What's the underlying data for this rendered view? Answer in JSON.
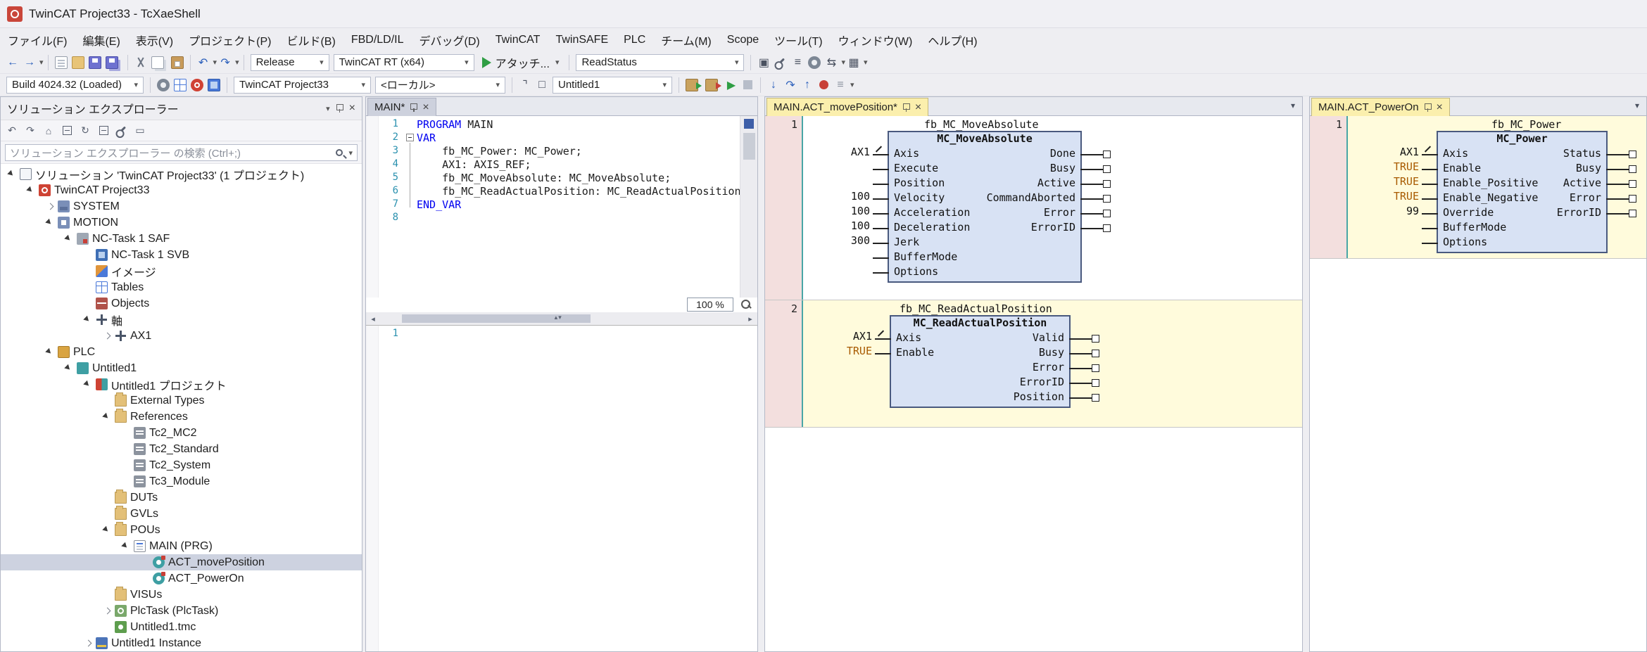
{
  "window": {
    "title": "TwinCAT Project33 - TcXaeShell"
  },
  "menu": {
    "items": [
      "ファイル(F)",
      "編集(E)",
      "表示(V)",
      "プロジェクト(P)",
      "ビルド(B)",
      "FBD/LD/IL",
      "デバッグ(D)",
      "TwinCAT",
      "TwinSAFE",
      "PLC",
      "チーム(M)",
      "Scope",
      "ツール(T)",
      "ウィンドウ(W)",
      "ヘルプ(H)"
    ]
  },
  "toolbar_standard": {
    "solution_config": "Release",
    "platform": "TwinCAT RT (x64)",
    "attach": "アタッチ...",
    "readstatus": "ReadStatus",
    "icons": [
      "nav-back-icon",
      "nav-forward-icon",
      "new-file-icon",
      "open-file-icon",
      "save-icon",
      "save-all-icon",
      "cut-icon",
      "copy-icon",
      "paste-icon",
      "undo-icon",
      "redo-icon",
      "solution-explorer-icon",
      "properties-window-icon",
      "task-list-icon",
      "gear-icon",
      "compare-icon",
      "grid-icon"
    ]
  },
  "toolbar_twincat": {
    "build": "Build 4024.32 (Loaded)",
    "project": "TwinCAT Project33",
    "target": "<ローカル>",
    "plc_project": "Untitled1",
    "icons": [
      "activate-configuration-icon",
      "restart-twincat-icon",
      "twincat-logo-icon",
      "config-mode-icon",
      "plug-icon",
      "monitor-icon",
      "login-icon",
      "logout-icon",
      "start-icon",
      "stop-icon",
      "step-into-icon",
      "step-over-icon",
      "step-out-icon",
      "breakpoint-icon",
      "list-icon"
    ]
  },
  "solution_explorer": {
    "title": "ソリューション エクスプローラー",
    "search_placeholder": "ソリューション エクスプローラー の検索 (Ctrl+;)",
    "toolbar_icons": [
      "back-icon",
      "forward-icon",
      "home-icon",
      "switch-views-icon",
      "refresh-icon",
      "collapse-all-icon",
      "properties-icon",
      "preview-icon"
    ],
    "items": [
      {
        "label": "ソリューション 'TwinCAT Project33' (1 プロジェクト)",
        "icon": "solution-icon"
      },
      {
        "label": "TwinCAT Project33",
        "icon": "twincat-project-icon"
      },
      {
        "label": "SYSTEM",
        "icon": "system-icon"
      },
      {
        "label": "MOTION",
        "icon": "motion-icon"
      },
      {
        "label": "NC-Task 1 SAF",
        "icon": "nc-task-icon"
      },
      {
        "label": "NC-Task 1 SVB",
        "icon": "nc-task-svb-icon"
      },
      {
        "label": "イメージ",
        "icon": "image-icon"
      },
      {
        "label": "Tables",
        "icon": "tables-icon"
      },
      {
        "label": "Objects",
        "icon": "objects-icon"
      },
      {
        "label": "軸",
        "icon": "axes-icon"
      },
      {
        "label": "AX1",
        "icon": "axis-icon"
      },
      {
        "label": "PLC",
        "icon": "plc-icon"
      },
      {
        "label": "Untitled1",
        "icon": "plc-project-icon"
      },
      {
        "label": "Untitled1 プロジェクト",
        "icon": "plc-project-node-icon"
      },
      {
        "label": "External Types",
        "icon": "folder-icon"
      },
      {
        "label": "References",
        "icon": "folder-icon"
      },
      {
        "label": "Tc2_MC2",
        "icon": "reference-icon"
      },
      {
        "label": "Tc2_Standard",
        "icon": "reference-icon"
      },
      {
        "label": "Tc2_System",
        "icon": "reference-icon"
      },
      {
        "label": "Tc3_Module",
        "icon": "reference-icon"
      },
      {
        "label": "DUTs",
        "icon": "folder-icon"
      },
      {
        "label": "GVLs",
        "icon": "folder-icon"
      },
      {
        "label": "POUs",
        "icon": "folder-icon"
      },
      {
        "label": "MAIN (PRG)",
        "icon": "pou-icon"
      },
      {
        "label": "ACT_movePosition",
        "icon": "action-icon"
      },
      {
        "label": "ACT_PowerOn",
        "icon": "action-icon"
      },
      {
        "label": "VISUs",
        "icon": "folder-icon"
      },
      {
        "label": "PlcTask (PlcTask)",
        "icon": "plctask-icon"
      },
      {
        "label": "Untitled1.tmc",
        "icon": "tmc-file-icon"
      },
      {
        "label": "Untitled1 Instance",
        "icon": "instance-icon"
      }
    ]
  },
  "code_editor": {
    "tab": "MAIN*",
    "zoom": "100 %",
    "decl_numbers": [
      "1",
      "2",
      "3",
      "4",
      "5",
      "6",
      "7",
      "8"
    ],
    "impl_numbers": [
      "1"
    ],
    "lines": [
      {
        "kw": "PROGRAM",
        "rest": " MAIN"
      },
      {
        "kw": "VAR",
        "rest": ""
      },
      {
        "kw": "",
        "rest": "    fb_MC_Power: MC_Power;"
      },
      {
        "kw": "",
        "rest": "    AX1: AXIS_REF;"
      },
      {
        "kw": "",
        "rest": "    fb_MC_MoveAbsolute: MC_MoveAbsolute;"
      },
      {
        "kw": "",
        "rest": "    fb_MC_ReadActualPosition: MC_ReadActualPosition;"
      },
      {
        "kw": "END_VAR",
        "rest": ""
      },
      {
        "kw": "",
        "rest": ""
      }
    ]
  },
  "fbd_move": {
    "tab": "MAIN.ACT_movePosition*",
    "networks": [
      {
        "number": "1",
        "instance": "fb_MC_MoveAbsolute",
        "type": "MC_MoveAbsolute",
        "inputs": [
          {
            "name": "Axis",
            "operand": "AX1"
          },
          {
            "name": "Execute",
            "operand": ""
          },
          {
            "name": "Position",
            "operand": ""
          },
          {
            "name": "Velocity",
            "operand": "100"
          },
          {
            "name": "Acceleration",
            "operand": "100"
          },
          {
            "name": "Deceleration",
            "operand": "100"
          },
          {
            "name": "Jerk",
            "operand": "300"
          },
          {
            "name": "BufferMode",
            "operand": ""
          },
          {
            "name": "Options",
            "operand": ""
          }
        ],
        "outputs": [
          "Done",
          "Busy",
          "Active",
          "CommandAborted",
          "Error",
          "ErrorID"
        ]
      },
      {
        "number": "2",
        "instance": "fb_MC_ReadActualPosition",
        "type": "MC_ReadActualPosition",
        "inputs": [
          {
            "name": "Axis",
            "operand": "AX1"
          },
          {
            "name": "Enable",
            "operand": "TRUE"
          }
        ],
        "outputs": [
          "Valid",
          "Busy",
          "Error",
          "ErrorID",
          "Position"
        ]
      }
    ]
  },
  "fbd_power": {
    "tab": "MAIN.ACT_PowerOn",
    "networks": [
      {
        "number": "1",
        "instance": "fb_MC_Power",
        "type": "MC_Power",
        "inputs": [
          {
            "name": "Axis",
            "operand": "AX1"
          },
          {
            "name": "Enable",
            "operand": "TRUE"
          },
          {
            "name": "Enable_Positive",
            "operand": "TRUE"
          },
          {
            "name": "Enable_Negative",
            "operand": "TRUE"
          },
          {
            "name": "Override",
            "operand": "99"
          },
          {
            "name": "BufferMode",
            "operand": ""
          },
          {
            "name": "Options",
            "operand": ""
          }
        ],
        "outputs": [
          "Status",
          "Busy",
          "Active",
          "Error",
          "ErrorID"
        ]
      }
    ]
  }
}
